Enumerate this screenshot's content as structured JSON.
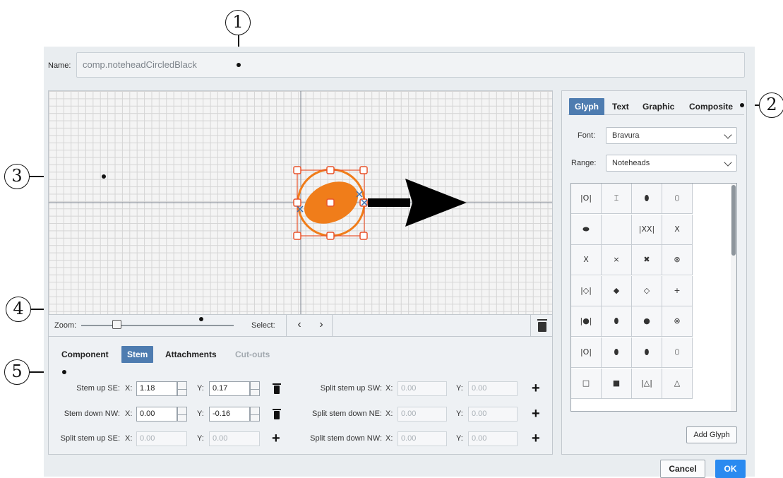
{
  "callouts": [
    "1",
    "2",
    "3",
    "4",
    "5"
  ],
  "name": {
    "label": "Name:",
    "value": "comp.noteheadCircledBlack"
  },
  "right_panel": {
    "tabs": [
      "Glyph",
      "Text",
      "Graphic",
      "Composite"
    ],
    "active_tab": "Glyph",
    "font_label": "Font:",
    "font_value": "Bravura",
    "range_label": "Range:",
    "range_value": "Noteheads",
    "glyphs": [
      [
        "|O|",
        "⌶",
        "⬮",
        "⬯"
      ],
      [
        "⬬",
        "",
        "|XX|",
        "X"
      ],
      [
        "X",
        "×",
        "✖",
        "⊗"
      ],
      [
        "|◇|",
        "◆",
        "◇",
        "+"
      ],
      [
        "|●|",
        "⬮",
        "●",
        "⊗"
      ],
      [
        "|O|",
        "⬮",
        "⬮",
        "⬯"
      ],
      [
        "□",
        "■",
        "|△|",
        "△"
      ]
    ],
    "add_glyph": "Add Glyph"
  },
  "toolbar": {
    "zoom_label": "Zoom:",
    "select_label": "Select:",
    "zoom_level": 0.2
  },
  "bottom_tabs": {
    "items": [
      "Component",
      "Stem",
      "Attachments",
      "Cut-outs"
    ],
    "active": "Stem"
  },
  "stem_rows": [
    {
      "label": "Stem up SE:",
      "x_label": "X:",
      "x": "1.18",
      "y_label": "Y:",
      "y": "0.17",
      "action": "delete"
    },
    {
      "label": "Stem down NW:",
      "x_label": "X:",
      "x": "0.00",
      "y_label": "Y:",
      "y": "-0.16",
      "action": "delete"
    },
    {
      "label": "Split stem up SE:",
      "x_label": "X:",
      "x": "0.00",
      "y_label": "Y:",
      "y": "0.00",
      "action": "add"
    }
  ],
  "split_rows": [
    {
      "label": "Split stem up SW:",
      "x_label": "X:",
      "x": "0.00",
      "y_label": "Y:",
      "y": "0.00"
    },
    {
      "label": "Split stem down NE:",
      "x_label": "X:",
      "x": "0.00",
      "y_label": "Y:",
      "y": "0.00"
    },
    {
      "label": "Split stem down NW:",
      "x_label": "X:",
      "x": "0.00",
      "y_label": "Y:",
      "y": "0.00"
    }
  ],
  "buttons": {
    "cancel": "Cancel",
    "ok": "OK"
  },
  "colors": {
    "accent": "#4e7cb0",
    "ok": "#2a8af0",
    "notehead": "#f07d1a",
    "handle": "#e8532b"
  }
}
